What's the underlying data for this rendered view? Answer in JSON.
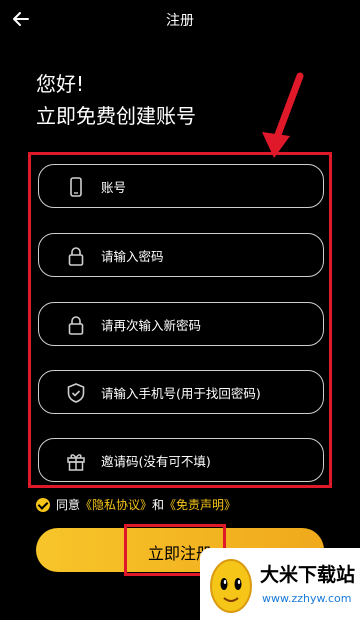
{
  "header": {
    "title": "注册",
    "back_icon": "arrow-left-icon"
  },
  "greeting": {
    "line1": "您好!",
    "line2": "立即免费创建账号"
  },
  "form": {
    "fields": [
      {
        "icon": "phone-icon",
        "placeholder": "账号"
      },
      {
        "icon": "lock-icon",
        "placeholder": "请输入密码"
      },
      {
        "icon": "lock-icon",
        "placeholder": "请再次输入新密码"
      },
      {
        "icon": "shield-icon",
        "placeholder": "请输入手机号(用于找回密码)"
      },
      {
        "icon": "gift-icon",
        "placeholder": "邀请码(没有可不填)"
      }
    ]
  },
  "agreement": {
    "prefix": "同意",
    "privacy": "《隐私协议》",
    "and": "和",
    "disclaimer": "《免责声明》",
    "checked": true
  },
  "submit": {
    "label": "立即注册"
  },
  "watermark": {
    "name": "大米下载站",
    "url": "www.zzhyw.com"
  },
  "colors": {
    "accent": "#f5c518",
    "highlight": "#e0192a",
    "background": "#000000"
  }
}
